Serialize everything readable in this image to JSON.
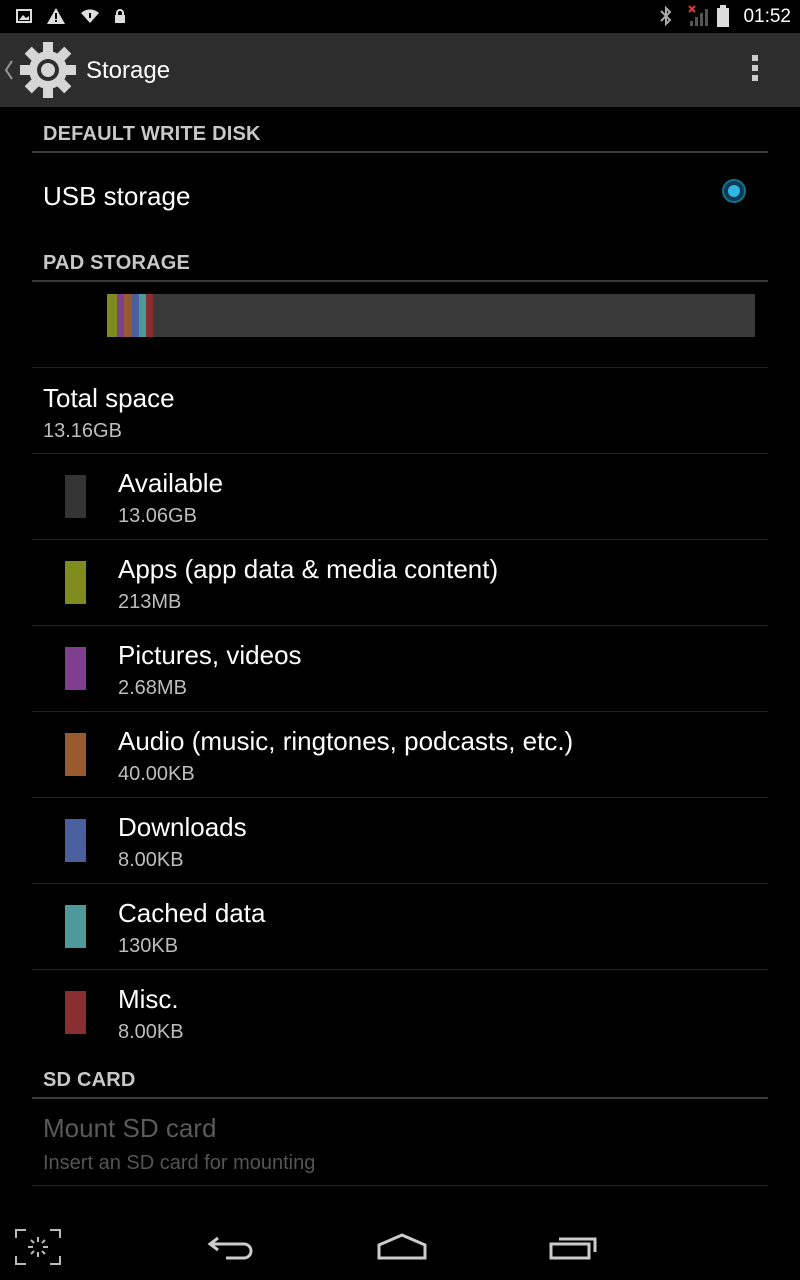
{
  "status_bar": {
    "time": "01:52",
    "left_icons": [
      "image-notification-icon",
      "warning-icon",
      "wifi-icon",
      "lock-icon"
    ],
    "right_icons": [
      "bluetooth-icon",
      "no-signal-icon",
      "battery-icon"
    ]
  },
  "action_bar": {
    "title": "Storage",
    "icons": [
      "up-caret-icon",
      "settings-gear-icon",
      "overflow-menu-icon"
    ]
  },
  "default_write_disk": {
    "header": "DEFAULT WRITE DISK",
    "option_label": "USB storage",
    "selected": true
  },
  "pad_storage": {
    "header": "PAD STORAGE",
    "usage_bar": {
      "segments": [
        {
          "label": "Apps (app data & media content)",
          "color": "#7f8b1c",
          "fraction": 0.016
        },
        {
          "label": "Pictures, videos",
          "color": "#7e3f8f",
          "fraction": 0.011
        },
        {
          "label": "Audio (music, ringtones, podcasts, etc.)",
          "color": "#9a5a2f",
          "fraction": 0.011
        },
        {
          "label": "Downloads",
          "color": "#4a5f9e",
          "fraction": 0.011
        },
        {
          "label": "Cached data",
          "color": "#4e9a9a",
          "fraction": 0.011
        },
        {
          "label": "Misc.",
          "color": "#8a2f2f",
          "fraction": 0.011
        }
      ],
      "background_color": "#3a3a3a"
    },
    "total": {
      "label": "Total space",
      "value": "13.16GB"
    },
    "items": [
      {
        "label": "Available",
        "value": "13.06GB",
        "color": "#353535"
      },
      {
        "label": "Apps (app data & media content)",
        "value": "213MB",
        "color": "#7f8b1c"
      },
      {
        "label": "Pictures, videos",
        "value": "2.68MB",
        "color": "#7e3f8f"
      },
      {
        "label": "Audio (music, ringtones, podcasts, etc.)",
        "value": "40.00KB",
        "color": "#9a5a2f"
      },
      {
        "label": "Downloads",
        "value": "8.00KB",
        "color": "#4a5f9e"
      },
      {
        "label": "Cached data",
        "value": "130KB",
        "color": "#4e9a9a"
      },
      {
        "label": "Misc.",
        "value": "8.00KB",
        "color": "#8a2f2f"
      }
    ]
  },
  "sd_card": {
    "header": "SD CARD",
    "mount_label": "Mount SD card",
    "mount_sub": "Insert an SD card for mounting",
    "enabled": false
  },
  "nav_bar": {
    "icons": [
      "screenshot-icon",
      "back-icon",
      "home-icon",
      "recent-apps-icon"
    ]
  }
}
